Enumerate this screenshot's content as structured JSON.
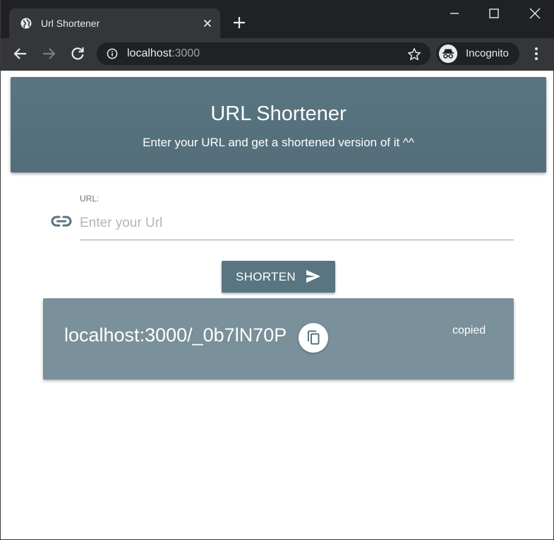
{
  "browser": {
    "tab_title": "Url Shortener",
    "address_host": "localhost",
    "address_port": ":3000",
    "profile_label": "Incognito"
  },
  "header": {
    "title": "URL Shortener",
    "subtitle": "Enter your URL and get a shortened version of it ^^"
  },
  "form": {
    "url_label": "URL:",
    "url_placeholder": "Enter your Url",
    "url_value": "",
    "submit_label": "SHORTEN"
  },
  "result": {
    "short_url": "localhost:3000/_0b7lN70P",
    "copied_status": "copied"
  },
  "colors": {
    "primary": "#587581",
    "result_background": "#7a909a",
    "chrome_dark": "#202124",
    "chrome_toolbar": "#35363a"
  },
  "icons": {
    "tab_favicon": "globe-icon",
    "tab_close": "close-icon",
    "new_tab": "plus-icon",
    "nav_back": "arrow-back-icon",
    "nav_forward": "arrow-forward-icon",
    "reload": "reload-icon",
    "site_info": "info-icon",
    "bookmark": "star-icon",
    "incognito": "incognito-icon",
    "menu": "kebab-menu-icon",
    "url_field": "link-icon",
    "submit": "send-icon",
    "copy": "copy-icon"
  }
}
